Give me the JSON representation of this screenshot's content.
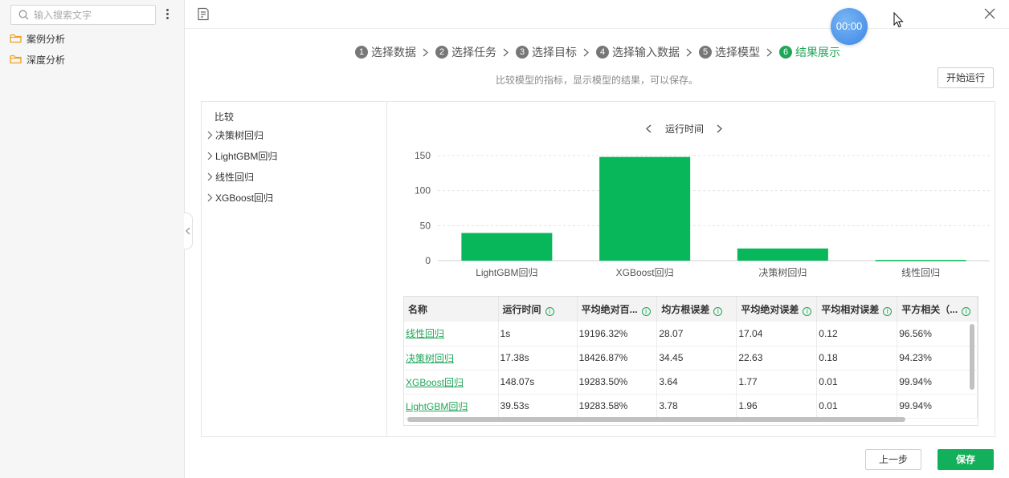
{
  "sidebar": {
    "search_placeholder": "输入搜索文字",
    "items": [
      {
        "label": "案例分析",
        "icon": "folder-icon"
      },
      {
        "label": "深度分析",
        "icon": "folder-icon"
      }
    ]
  },
  "timer": "00:00",
  "steps": [
    {
      "num": "1",
      "label": "选择数据"
    },
    {
      "num": "2",
      "label": "选择任务"
    },
    {
      "num": "3",
      "label": "选择目标"
    },
    {
      "num": "4",
      "label": "选择输入数据"
    },
    {
      "num": "5",
      "label": "选择模型"
    },
    {
      "num": "6",
      "label": "结果展示",
      "active": true
    }
  ],
  "hint": "比较模型的指标，显示模型的结果，可以保存。",
  "run_button": "开始运行",
  "tree": {
    "title": "比较",
    "nodes": [
      "决策树回归",
      "LightGBM回归",
      "线性回归",
      "XGBoost回归"
    ]
  },
  "chart_nav_label": "运行时间",
  "chart_data": {
    "type": "bar",
    "title": "运行时间",
    "categories": [
      "LightGBM回归",
      "XGBoost回归",
      "决策树回归",
      "线性回归"
    ],
    "values": [
      39.53,
      148.07,
      17.38,
      1
    ],
    "yticks": [
      0,
      50,
      100,
      150
    ],
    "ylim": [
      0,
      150
    ],
    "grid": true,
    "bar_color": "#07b75a"
  },
  "table": {
    "headers": [
      "名称",
      "运行时间",
      "平均绝对百...",
      "均方根误差",
      "平均绝对误差",
      "平均相对误差",
      "平方相关（..."
    ],
    "rows": [
      [
        "线性回归",
        "1s",
        "19196.32%",
        "28.07",
        "17.04",
        "0.12",
        "96.56%"
      ],
      [
        "决策树回归",
        "17.38s",
        "18426.87%",
        "34.45",
        "22.63",
        "0.18",
        "94.23%"
      ],
      [
        "XGBoost回归",
        "148.07s",
        "19283.50%",
        "3.64",
        "1.77",
        "0.01",
        "99.94%"
      ],
      [
        "LightGBM回归",
        "39.53s",
        "19283.58%",
        "3.78",
        "1.96",
        "0.01",
        "99.94%"
      ]
    ]
  },
  "prev_button": "上一步",
  "save_button": "保存",
  "colors": {
    "accent": "#1fa657",
    "bar": "#07b75a",
    "timer": "#3b86e6"
  }
}
